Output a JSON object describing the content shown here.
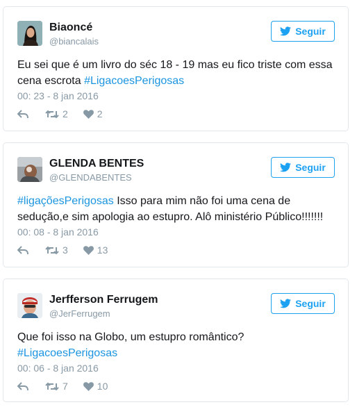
{
  "tweets": [
    {
      "name": "Biaoncé",
      "handle": "@biancalais",
      "follow_label": "Seguir",
      "text_before": "Eu sei que é um livro do séc 18 - 19 mas eu fico triste com essa cena escrota ",
      "hashtag": "#LigacoesPerigosas",
      "text_after": "",
      "time": "00: 23 - 8 jan 2016",
      "retweets": "2",
      "likes": "2"
    },
    {
      "name": "GLENDA BENTES",
      "handle": "@GLENDABENTES",
      "follow_label": "Seguir",
      "hashtag": "#ligaçõesPerigosas",
      "text_after": " Isso para mim não foi uma cena de sedução,e sim apologia ao estupro. Alô ministério Público!!!!!!!",
      "time": "00: 08 - 8 jan 2016",
      "retweets": "3",
      "likes": "13"
    },
    {
      "name": "Jerfferson Ferrugem",
      "handle": "@JerFerrugem",
      "follow_label": "Seguir",
      "text_before": "Que foi isso na Globo, um estupro romântico?",
      "hashtag": "#LigacoesPerigosas",
      "time": "00: 06 - 8 jan 2016",
      "retweets": "7",
      "likes": "10"
    }
  ],
  "colors": {
    "accent": "#1da1f2",
    "hashtag": "#1b95e0",
    "muted": "#8899a6",
    "border": "#e1e8ed"
  },
  "icons": [
    "twitter-bird-icon",
    "reply-icon",
    "retweet-icon",
    "heart-icon"
  ]
}
